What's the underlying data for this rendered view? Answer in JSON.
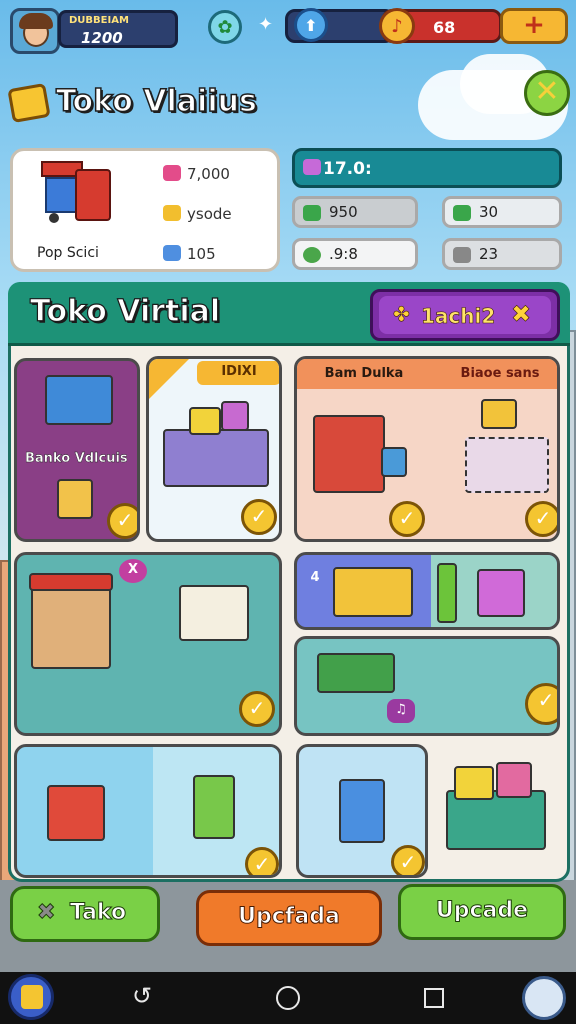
{
  "header": {
    "player_name": "DUBBEIAM",
    "coins": "1200",
    "gems": "68"
  },
  "shop": {
    "title": "Toko Vlaiius",
    "owner_label": "Pop Scici",
    "stats": [
      "7,000",
      "ysode",
      "105"
    ],
    "bar_value": "17.0:",
    "pills": [
      "950",
      "30",
      ".9:8",
      "23"
    ]
  },
  "panel": {
    "title": "Toko Virtial",
    "badge_label": "1achi2",
    "tiles": {
      "bank_label": "Banko Vdlcuis",
      "crate_tag": "IDIXI",
      "stall_tag": "Bam Dulka",
      "cart_tag": "Biaoe sans",
      "hex_badge": "X",
      "num_badge": "4"
    }
  },
  "buttons": {
    "left": "Tako",
    "middle": "Upcfada",
    "right": "Upcade"
  },
  "colors": {
    "panel_header": "#1d9277",
    "purple": "#7d2fa6",
    "orange": "#f07a2a",
    "green": "#6cc43a"
  },
  "icons": [
    "avatar",
    "leaf-icon",
    "energy-icon",
    "gem-icon",
    "plus-icon",
    "close-icon",
    "back-icon",
    "home-icon",
    "recents-icon"
  ]
}
